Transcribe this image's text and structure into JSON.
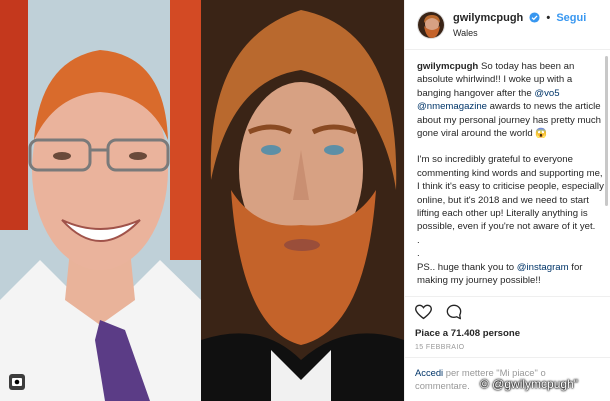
{
  "post": {
    "username": "gwilymcpugh",
    "follow_label": "Segui",
    "separator": "•",
    "location": "Wales",
    "caption": {
      "author": "gwilymcpugh",
      "p1_text_a": " So today has been an absolute whirlwind!! I woke up with a banging hangover after the ",
      "p1_mention1": "@vo5",
      "p1_text_b": " ",
      "p1_mention2": "@nmemagazine",
      "p1_text_c": " awards to news the article about my personal journey has pretty much gone viral around the world 😱",
      "p2": "I'm so incredibly grateful to everyone commenting kind words and supporting me, I think it's easy to criticise people, especially online, but it's 2018 and we need to start lifting each other up! Literally anything is possible, even if you're not aware of it yet.",
      "dot1": ".",
      "dot2": ".",
      "p3_text_a": "PS.. huge thank you to ",
      "p3_mention": "@instagram",
      "p3_text_b": " for making my journey possible!!",
      "dot3": ".",
      "dot4": "."
    },
    "likes_text": "Piace a 71.408 persone",
    "date_text": "15 FEBBRAIO",
    "comment_login": "Accedi",
    "comment_rest": " per mettere \"Mi piace\" o commentare."
  },
  "watermark": "© @gwilymcpugh\"",
  "icons": {
    "verified": "verified-badge-icon",
    "like": "heart-icon",
    "comment": "comment-bubble-icon",
    "gallery": "gallery-icon"
  },
  "colors": {
    "link": "#003569",
    "follow": "#3897f0",
    "verified": "#3897f0",
    "text": "#262626",
    "muted": "#999999"
  }
}
